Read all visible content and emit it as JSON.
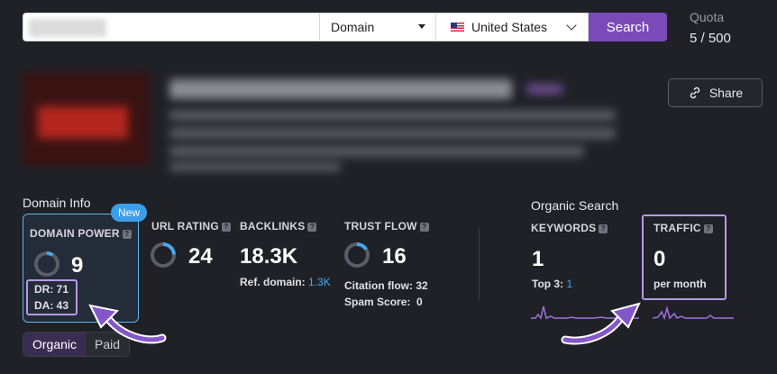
{
  "search": {
    "input_value": "",
    "domain_select": "Domain",
    "country_select": "United States",
    "button_label": "Search"
  },
  "quota": {
    "label": "Quota",
    "value": "5 / 500"
  },
  "share": {
    "label": "Share"
  },
  "domain_info": {
    "title": "Domain Info",
    "new_badge": "New",
    "domain_power": {
      "label": "DOMAIN POWER",
      "value": "9",
      "dr": "DR: 71",
      "da": "DA: 43"
    },
    "url_rating": {
      "label": "URL RATING",
      "value": "24"
    },
    "backlinks": {
      "label": "BACKLINKS",
      "value": "18.3K",
      "ref_label": "Ref. domain:",
      "ref_value": "1.3K"
    },
    "trust_flow": {
      "label": "TRUST FLOW",
      "value": "16",
      "citation": "Citation flow: 32",
      "spam": "Spam Score:  0"
    }
  },
  "organic_search": {
    "title": "Organic Search",
    "keywords": {
      "label": "KEYWORDS",
      "value": "1",
      "top3_label": "Top 3:",
      "top3_value": "1"
    },
    "traffic": {
      "label": "TRAFFIC",
      "value": "0",
      "unit": "per month"
    }
  },
  "tabs": [
    {
      "label": "Organic",
      "active": true
    },
    {
      "label": "Paid",
      "active": false
    }
  ],
  "icons": {
    "help": "?",
    "link": "link-icon"
  },
  "colors": {
    "accent": "#7a4bb8",
    "blue": "#3b9ee8",
    "highlight": "#b899e8",
    "background": "#1f2127"
  }
}
